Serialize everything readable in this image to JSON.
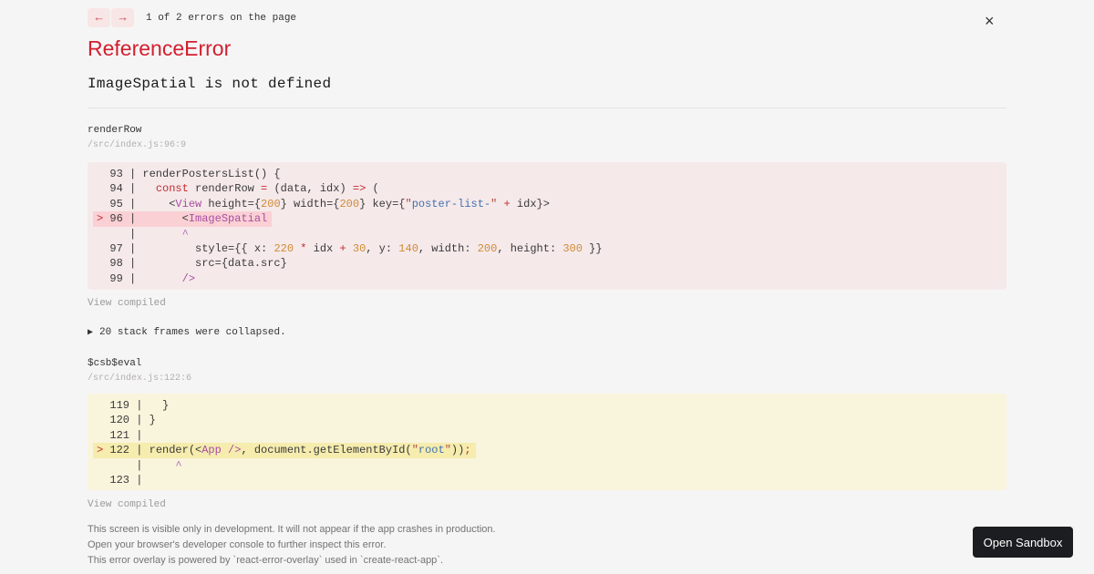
{
  "topbar": {
    "prev_label": "←",
    "next_label": "→",
    "counter": "1 of 2 errors on the page",
    "close_label": "×"
  },
  "error": {
    "name": "ReferenceError",
    "message": "ImageSpatial is not defined"
  },
  "frames": [
    {
      "function": "renderRow",
      "location": "/src/index.js:96:9",
      "view_compiled_label": "View compiled",
      "variant": "error",
      "lines": [
        {
          "hl": false,
          "seg": [
            [
              "d",
              "  93 | renderPostersList() {"
            ]
          ]
        },
        {
          "hl": false,
          "seg": [
            [
              "d",
              "  94 |   "
            ],
            [
              "k",
              "const"
            ],
            [
              "d",
              " renderRow "
            ],
            [
              "k",
              "="
            ],
            [
              "d",
              " (data, idx) "
            ],
            [
              "k",
              "=>"
            ],
            [
              "d",
              " ("
            ]
          ]
        },
        {
          "hl": false,
          "seg": [
            [
              "d",
              "  95 |     <"
            ],
            [
              "t",
              "View"
            ],
            [
              "d",
              " height={"
            ],
            [
              "n",
              "200"
            ],
            [
              "d",
              "} width={"
            ],
            [
              "n",
              "200"
            ],
            [
              "d",
              "} key={"
            ],
            [
              "q",
              "\""
            ],
            [
              "s",
              "poster-list-"
            ],
            [
              "q",
              "\""
            ],
            [
              "d",
              " "
            ],
            [
              "k",
              "+"
            ],
            [
              "d",
              " idx}>"
            ]
          ]
        },
        {
          "hl": true,
          "seg": [
            [
              "k",
              ">"
            ],
            [
              "d",
              " 96 |       <"
            ],
            [
              "t",
              "ImageSpatial"
            ]
          ]
        },
        {
          "hl": false,
          "seg": [
            [
              "d",
              "     |       "
            ],
            [
              "c",
              "^"
            ]
          ]
        },
        {
          "hl": false,
          "seg": [
            [
              "d",
              "  97 |         style={{ x: "
            ],
            [
              "n",
              "220"
            ],
            [
              "d",
              " "
            ],
            [
              "k",
              "*"
            ],
            [
              "d",
              " idx "
            ],
            [
              "k",
              "+"
            ],
            [
              "d",
              " "
            ],
            [
              "n",
              "30"
            ],
            [
              "d",
              ", y: "
            ],
            [
              "n",
              "140"
            ],
            [
              "d",
              ", width: "
            ],
            [
              "n",
              "200"
            ],
            [
              "d",
              ", height: "
            ],
            [
              "n",
              "300"
            ],
            [
              "d",
              " }}"
            ]
          ]
        },
        {
          "hl": false,
          "seg": [
            [
              "d",
              "  98 |         src={data.src}"
            ]
          ]
        },
        {
          "hl": false,
          "seg": [
            [
              "d",
              "  99 |       "
            ],
            [
              "t",
              "/>"
            ]
          ]
        }
      ]
    },
    {
      "function": "$csb$eval",
      "location": "/src/index.js:122:6",
      "view_compiled_label": "View compiled",
      "variant": "warn",
      "lines": [
        {
          "hl": false,
          "seg": [
            [
              "d",
              "  119 |   }"
            ]
          ]
        },
        {
          "hl": false,
          "seg": [
            [
              "d",
              "  120 | }"
            ]
          ]
        },
        {
          "hl": false,
          "seg": [
            [
              "d",
              "  121 |"
            ]
          ]
        },
        {
          "hl": true,
          "seg": [
            [
              "k",
              ">"
            ],
            [
              "d",
              " 122 | render(<"
            ],
            [
              "t",
              "App"
            ],
            [
              "d",
              " "
            ],
            [
              "t",
              "/>"
            ],
            [
              "d",
              ", document.getElementById("
            ],
            [
              "q",
              "\""
            ],
            [
              "s",
              "root"
            ],
            [
              "q",
              "\""
            ],
            [
              "d",
              "))"
            ],
            [
              "k",
              ";"
            ]
          ]
        },
        {
          "hl": false,
          "seg": [
            [
              "d",
              "      |     "
            ],
            [
              "c",
              "^"
            ]
          ]
        },
        {
          "hl": false,
          "seg": [
            [
              "d",
              "  123 |"
            ]
          ]
        }
      ]
    }
  ],
  "stack_collapse": {
    "icon": "▶",
    "label": "20 stack frames were collapsed."
  },
  "footer": {
    "lines": [
      "This screen is visible only in development. It will not appear if the app crashes in production.",
      "Open your browser's developer console to further inspect this error.",
      "This error overlay is powered by `react-error-overlay` used in `create-react-app`."
    ]
  },
  "sandbox_button_label": "Open Sandbox",
  "colors": {
    "page_background": "#f6f5f5",
    "accent_red": "#d21f2f",
    "error_block_background": "#f5e9ea",
    "error_line_highlight": "#fad0d4",
    "warn_block_background": "#f9f4dc",
    "warn_line_highlight": "#f5ecae",
    "number_token": "#cf8b36",
    "string_token": "#4271ae",
    "tag_token": "#a84ea2",
    "keyword_token": "#c5292e",
    "sandbox_button_background": "#1b1d20"
  }
}
